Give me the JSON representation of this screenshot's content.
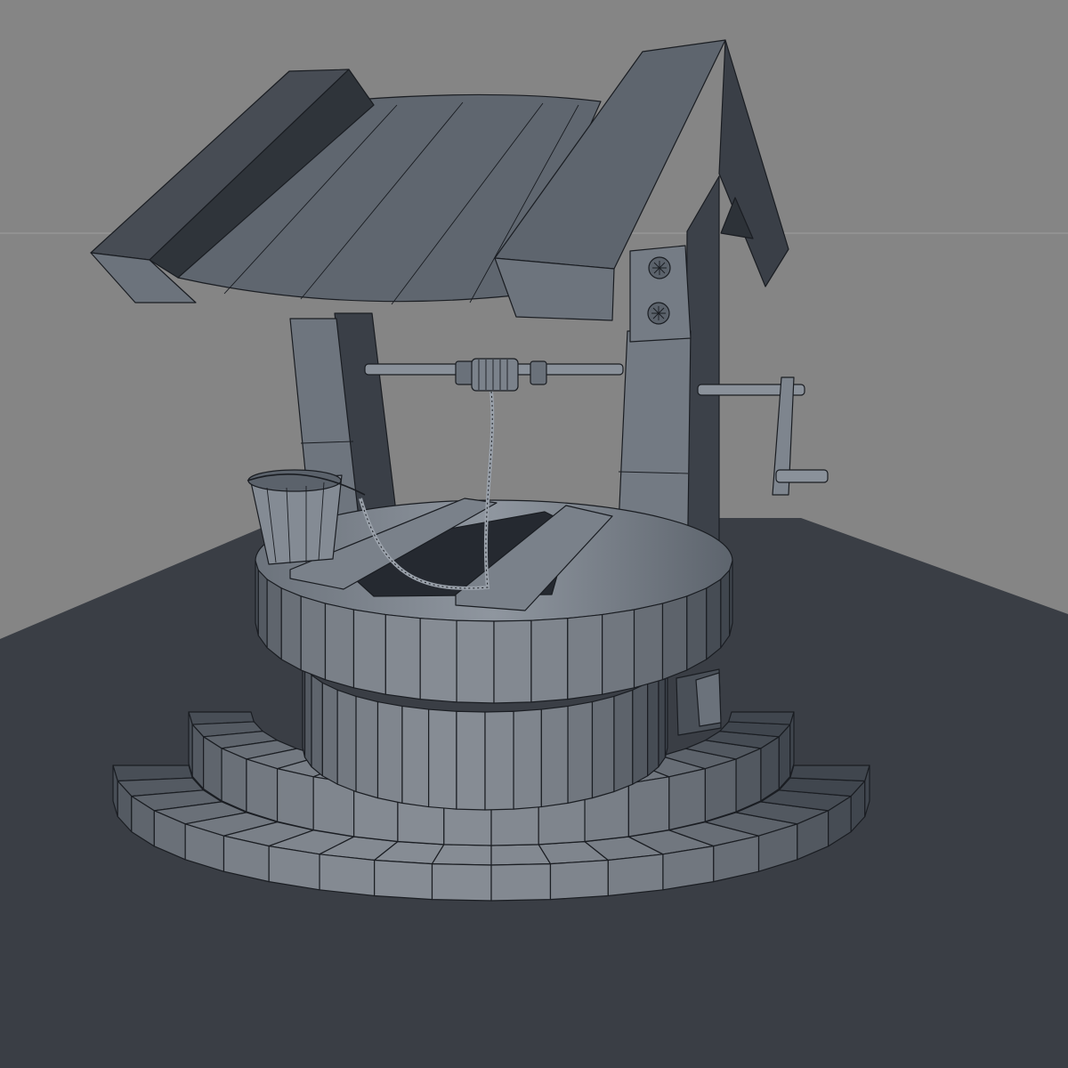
{
  "colors": {
    "background": "#858585",
    "floor": "#3a3e45",
    "model_light": "#8a929c",
    "model_mid": "#5a616b",
    "model_dark": "#30353c",
    "wire": "#1a1d22"
  },
  "ring_segments": 20
}
